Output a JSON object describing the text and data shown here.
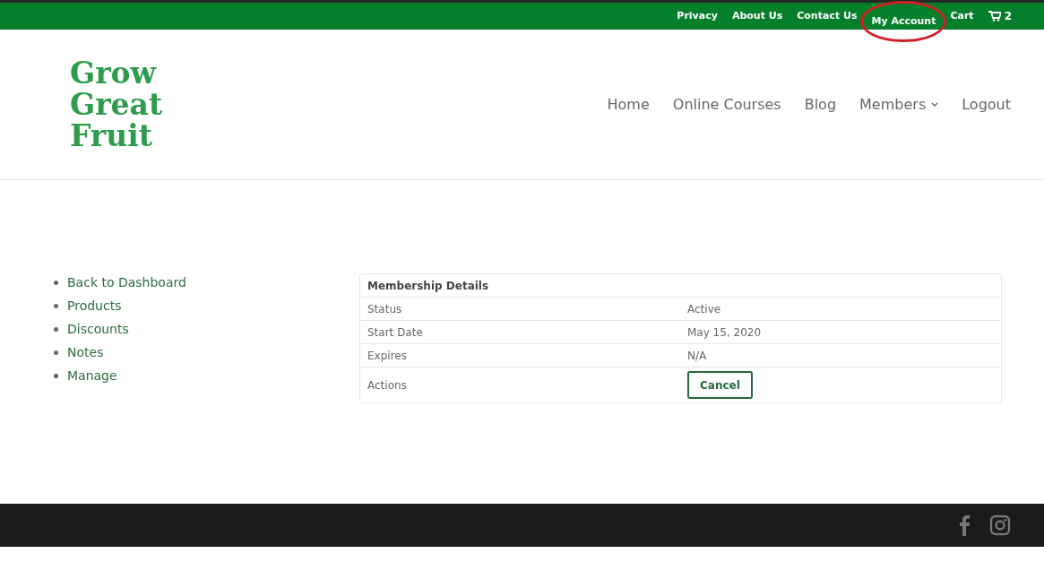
{
  "top_bar": {
    "links": [
      {
        "label": "Privacy",
        "circled": false
      },
      {
        "label": "About Us",
        "circled": false
      },
      {
        "label": "Contact Us",
        "circled": false
      },
      {
        "label": "My Account",
        "circled": true
      },
      {
        "label": "Cart",
        "circled": false
      }
    ],
    "cart_count": "2"
  },
  "logo": {
    "lines": [
      "Grow",
      "Great",
      "Fruit"
    ]
  },
  "main_nav": [
    {
      "label": "Home",
      "has_dropdown": false
    },
    {
      "label": "Online Courses",
      "has_dropdown": false
    },
    {
      "label": "Blog",
      "has_dropdown": false
    },
    {
      "label": "Members",
      "has_dropdown": true
    },
    {
      "label": "Logout",
      "has_dropdown": false
    }
  ],
  "sidebar": {
    "items": [
      "Back to Dashboard",
      "Products",
      "Discounts",
      "Notes",
      "Manage"
    ]
  },
  "membership_table": {
    "title": "Membership Details",
    "rows": [
      {
        "label": "Status",
        "kind": "text",
        "value": "Active"
      },
      {
        "label": "Start Date",
        "kind": "text",
        "value": "May 15, 2020"
      },
      {
        "label": "Expires",
        "kind": "text",
        "value": "N/A"
      },
      {
        "label": "Actions",
        "kind": "button",
        "value": "Cancel"
      }
    ]
  }
}
